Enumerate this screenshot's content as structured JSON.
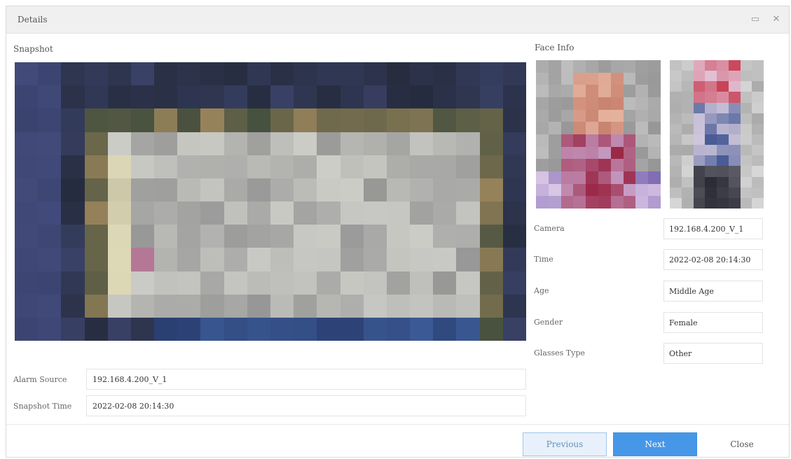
{
  "window": {
    "title": "Details",
    "restore_icon": "restore-icon",
    "close_icon": "close-icon"
  },
  "snapshot": {
    "label": "Snapshot"
  },
  "face_info": {
    "label": "Face Info"
  },
  "info_fields": [
    {
      "label": "Camera",
      "value": "192.168.4.200_V_1"
    },
    {
      "label": "Time",
      "value": "2022-02-08 20:14:30"
    },
    {
      "label": "Age",
      "value": "Middle Age"
    },
    {
      "label": "Gender",
      "value": "Female"
    },
    {
      "label": "Glasses Type",
      "value": "Other"
    }
  ],
  "alarm_source": {
    "label": "Alarm Source",
    "value": "192.168.4.200_V_1"
  },
  "snapshot_time": {
    "label": "Snapshot Time",
    "value": "2022-02-08 20:14:30"
  },
  "buttons": {
    "previous": "Previous",
    "next": "Next",
    "close": "Close"
  },
  "colors": {
    "accent": "#4697e8",
    "accent_light": "#e8f1fb",
    "border": "#e3e3e3",
    "titlebar": "#f0f0f0"
  }
}
